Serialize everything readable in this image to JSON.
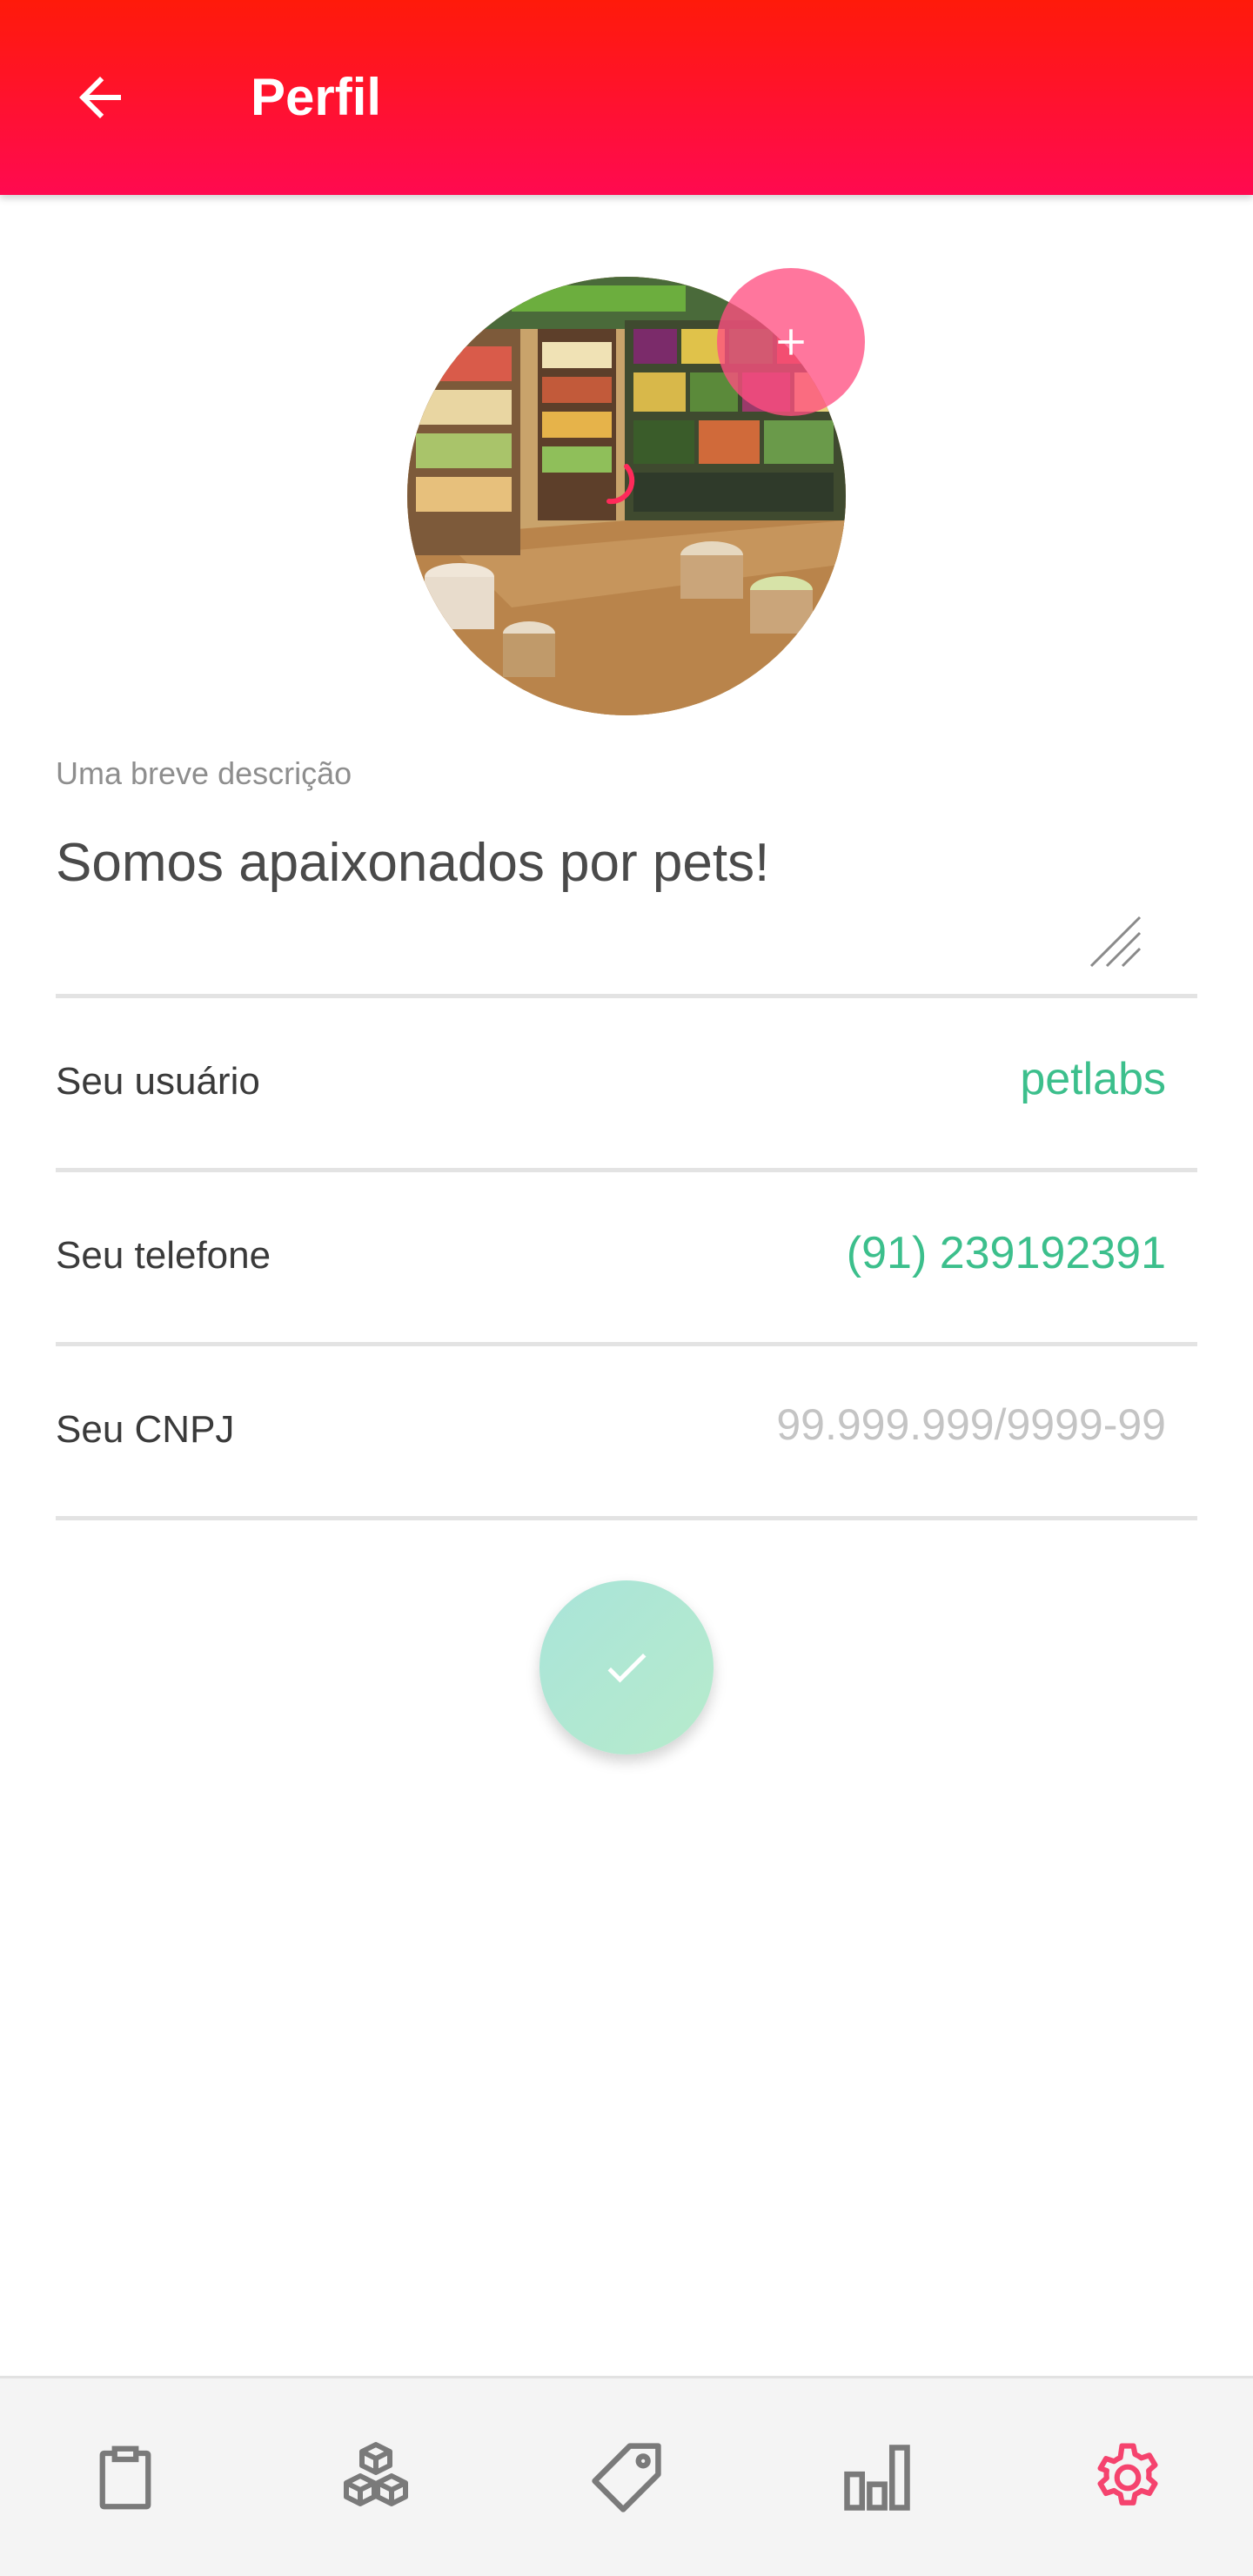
{
  "appbar": {
    "title": "Perfil",
    "back_icon": "arrow-left-icon"
  },
  "profile": {
    "photo_alt": "pet store",
    "add_photo_icon": "plus-icon"
  },
  "description": {
    "label": "Uma breve descrição",
    "value": "Somos apaixonados por pets!"
  },
  "fields": {
    "username": {
      "label": "Seu usuário",
      "value": "petlabs"
    },
    "phone": {
      "label": "Seu telefone",
      "value": "(91) 239192391"
    },
    "cnpj": {
      "label": "Seu CNPJ",
      "placeholder": "99.999.999/9999-99"
    }
  },
  "actions": {
    "save_icon": "check-icon"
  },
  "bottom_nav": {
    "items": [
      {
        "name": "orders",
        "icon": "clipboard-icon"
      },
      {
        "name": "products",
        "icon": "boxes-icon"
      },
      {
        "name": "promotions",
        "icon": "tag-icon"
      },
      {
        "name": "reports",
        "icon": "bar-chart-icon"
      },
      {
        "name": "settings",
        "icon": "gear-icon",
        "active": true
      }
    ]
  },
  "colors": {
    "appbar_top": "#ff1a0a",
    "appbar_bottom": "#ff0a50",
    "accent_green": "#3cbf8c",
    "active_nav": "#f5436e",
    "inactive_nav": "#7a7a7a"
  }
}
